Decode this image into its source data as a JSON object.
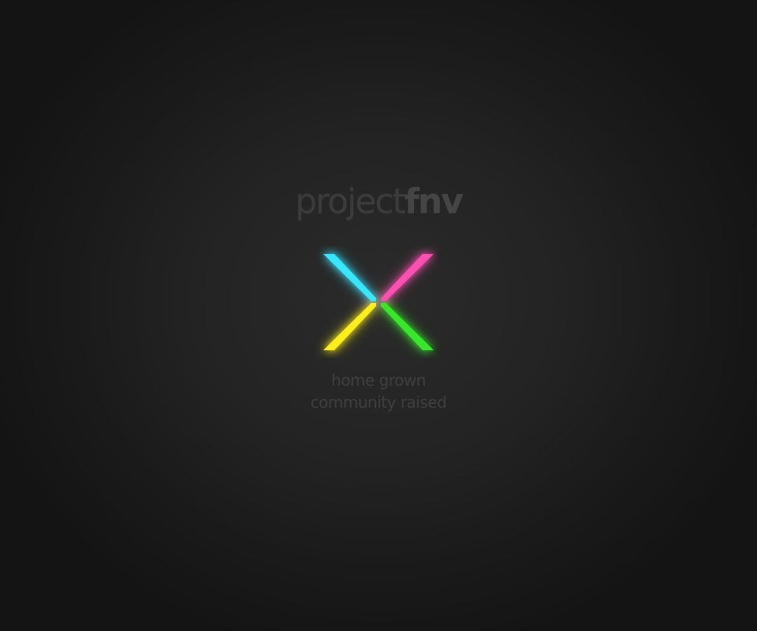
{
  "title": {
    "light": "project",
    "bold": "fnv"
  },
  "logo": {
    "icon": "nexus-x-icon",
    "colors": {
      "top_left": "#39e6ff",
      "top_right": "#ff4fb0",
      "bottom_left": "#ffee1a",
      "bottom_right": "#39e62a"
    }
  },
  "tagline": {
    "line1": "home grown",
    "line2": "community raised"
  }
}
